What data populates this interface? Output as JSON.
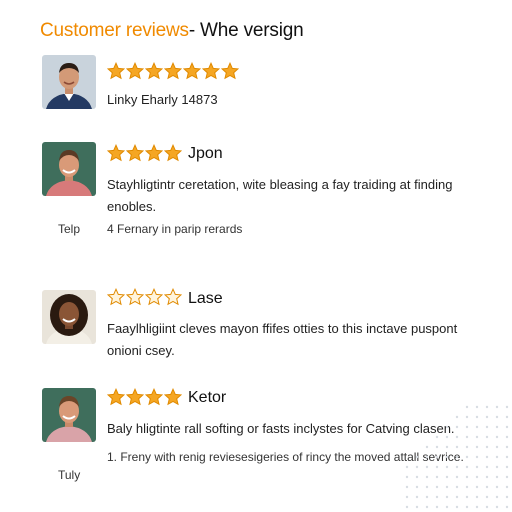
{
  "header": {
    "title_accent": "Customer reviews",
    "title_rest": "- Whe versign"
  },
  "reviews": [
    {
      "stars": 7,
      "star_style": "filled",
      "reviewer": "",
      "text": "Linky Eharly 14873",
      "side_label": "",
      "meta": ""
    },
    {
      "stars": 4,
      "star_style": "filled",
      "reviewer": "Jpon",
      "text": "Stayhligtintr ceretation, wite bleasing a fay traiding at finding enobles.",
      "side_label": "Telp",
      "meta": "4 Fernary in parip rerards"
    },
    {
      "stars": 4,
      "star_style": "outline",
      "reviewer": "Lase",
      "text": "Faaylhligiint cleves mayon ffifes otties to this inctave puspont onioni csey.",
      "side_label": "",
      "meta": ""
    },
    {
      "stars": 4,
      "star_style": "filled",
      "reviewer": "Ketor",
      "text": "Baly hligtinte rall softing or fasts inclystes for Catving clasen.",
      "side_label": "Tuly",
      "meta": "1. Freny with renig reviesesigeries of rincy the moved attall sevrice."
    }
  ],
  "colors": {
    "accent": "#f08a00",
    "star_fill": "#f5a623",
    "star_stroke": "#e08a00"
  },
  "icons": {
    "star": "star-icon",
    "avatar": "avatar"
  }
}
